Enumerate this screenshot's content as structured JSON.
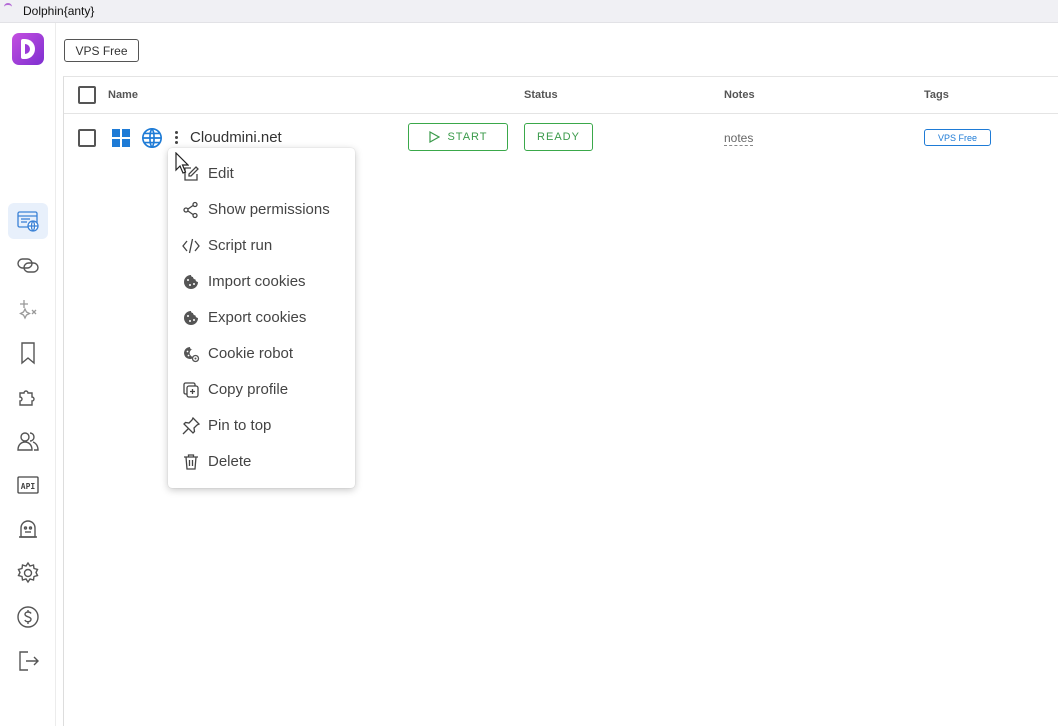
{
  "window": {
    "title": "Dolphin{anty}"
  },
  "sidebar": {
    "items": [
      {
        "name": "browser-profiles",
        "active": true
      },
      {
        "name": "proxies"
      },
      {
        "name": "automation"
      },
      {
        "name": "bookmarks"
      },
      {
        "name": "extensions"
      },
      {
        "name": "team"
      },
      {
        "name": "api",
        "label": "API"
      },
      {
        "name": "robot"
      },
      {
        "name": "settings"
      },
      {
        "name": "billing"
      },
      {
        "name": "logout"
      }
    ]
  },
  "toolbar": {
    "filter_button": "VPS Free"
  },
  "table": {
    "columns": {
      "name": "Name",
      "status": "Status",
      "notes": "Notes",
      "tags": "Tags"
    },
    "rows": [
      {
        "name": "Cloudmini.net",
        "start_label": "START",
        "status": "READY",
        "notes": "notes",
        "tag": "VPS Free"
      }
    ]
  },
  "context_menu": {
    "items": [
      {
        "label": "Edit",
        "icon": "edit-icon"
      },
      {
        "label": "Show permissions",
        "icon": "share-icon"
      },
      {
        "label": "Script run",
        "icon": "code-icon"
      },
      {
        "label": "Import cookies",
        "icon": "cookie-icon"
      },
      {
        "label": "Export cookies",
        "icon": "cookie-icon"
      },
      {
        "label": "Cookie robot",
        "icon": "cookie-gear-icon"
      },
      {
        "label": "Copy profile",
        "icon": "copy-icon"
      },
      {
        "label": "Pin to top",
        "icon": "pin-icon"
      },
      {
        "label": "Delete",
        "icon": "trash-icon"
      }
    ]
  },
  "colors": {
    "accent": "#1e7bd6",
    "success": "#3aa84a",
    "brand": "#9b3ad8"
  }
}
